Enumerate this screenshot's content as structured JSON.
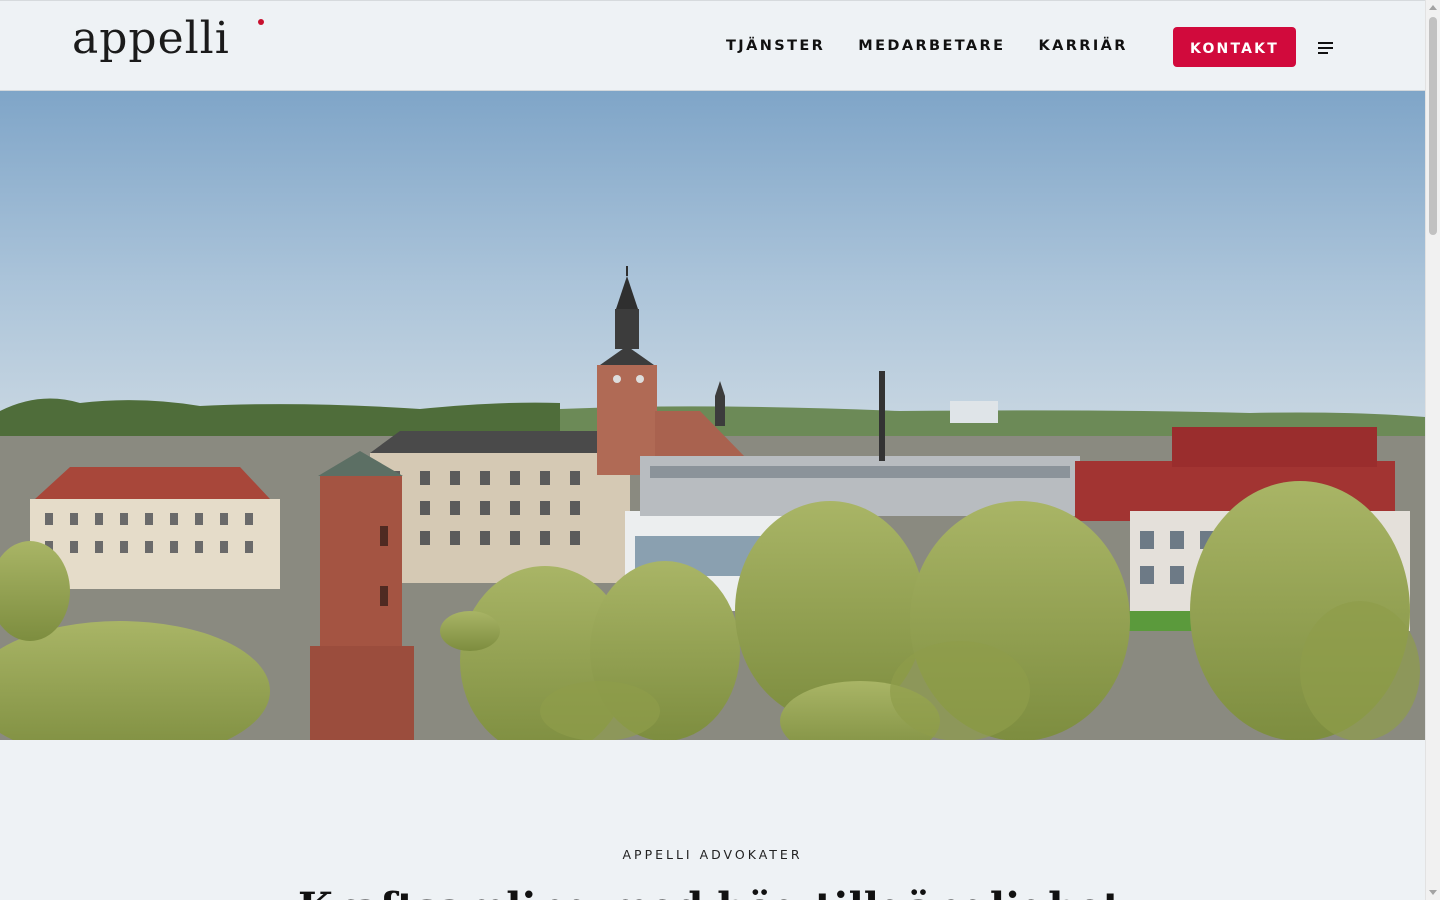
{
  "header": {
    "logo_text": "appelli",
    "nav": [
      {
        "label": "TJÄNSTER"
      },
      {
        "label": "MEDARBETARE"
      },
      {
        "label": "KARRIÄR"
      }
    ],
    "contact_label": "KONTAKT",
    "menu_icon": "hamburger-menu-icon"
  },
  "hero": {
    "image": "aerial-city-view"
  },
  "intro": {
    "eyebrow": "APPELLI ADVOKATER",
    "headline": "Kraftsamling med hög tillgänglighet"
  },
  "colors": {
    "accent": "#d10a3c",
    "background": "#eef2f5",
    "text": "#111111"
  }
}
